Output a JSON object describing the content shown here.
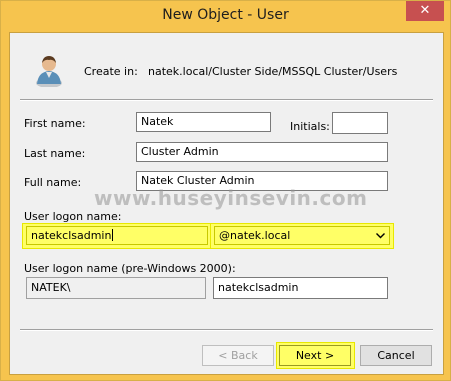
{
  "window": {
    "title": "New Object - User",
    "close_glyph": "✕"
  },
  "header": {
    "create_in_label": "Create in:",
    "create_in_path": "natek.local/Cluster Side/MSSQL Cluster/Users",
    "icon": "user-icon"
  },
  "form": {
    "first_name_label": "First name:",
    "first_name_value": "Natek",
    "initials_label": "Initials:",
    "initials_value": "",
    "last_name_label": "Last name:",
    "last_name_value": "Cluster Admin",
    "full_name_label": "Full name:",
    "full_name_value": "Natek Cluster Admin",
    "logon_label": "User logon name:",
    "logon_value": "natekclsadmin",
    "domain_value": "@natek.local",
    "pre2000_label": "User logon name (pre-Windows 2000):",
    "pre2000_domain": "NATEK\\",
    "pre2000_value": "natekclsadmin"
  },
  "watermark": "www.huseyinsevin.com",
  "buttons": {
    "back": "< Back",
    "next": "Next >",
    "cancel": "Cancel"
  },
  "colors": {
    "highlight": "#ffff66",
    "frame": "#f6c44e",
    "close": "#c75050"
  }
}
